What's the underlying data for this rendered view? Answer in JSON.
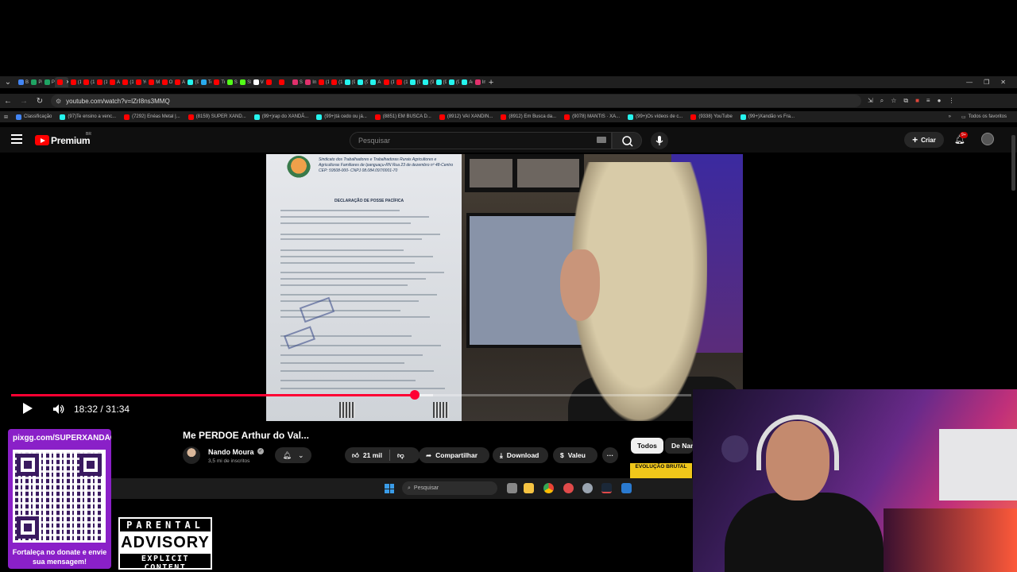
{
  "browser": {
    "tabs": [
      {
        "label": "Bi",
        "color": "#4285f4"
      },
      {
        "label": "Pi",
        "color": "#1fa463"
      },
      {
        "label": "Pi",
        "color": "#1fa463"
      },
      {
        "label": "",
        "color": "#ff0000",
        "active": true
      },
      {
        "label": "(1",
        "color": "#ff0000"
      },
      {
        "label": "(1",
        "color": "#ff0000"
      },
      {
        "label": "(1",
        "color": "#ff0000"
      },
      {
        "label": "A",
        "color": "#ff0000"
      },
      {
        "label": "(1",
        "color": "#ff0000"
      },
      {
        "label": "Yo",
        "color": "#ff0000"
      },
      {
        "label": "M",
        "color": "#ff0000"
      },
      {
        "label": "O",
        "color": "#ff0000"
      },
      {
        "label": "Al",
        "color": "#ff0000"
      },
      {
        "label": "(9",
        "color": "#25f4ee"
      },
      {
        "label": "Te",
        "color": "#2aabee"
      },
      {
        "label": "Tr",
        "color": "#ff0000"
      },
      {
        "label": "St",
        "color": "#53fc18"
      },
      {
        "label": "SI",
        "color": "#53fc18"
      },
      {
        "label": "Vi",
        "color": "#ffffff"
      },
      {
        "label": "",
        "color": "#ff0000"
      },
      {
        "label": "",
        "color": "#ff0000"
      },
      {
        "label": "St",
        "color": "#e1306c"
      },
      {
        "label": "In",
        "color": "#e1306c"
      },
      {
        "label": "(1",
        "color": "#ff0000"
      },
      {
        "label": "(1",
        "color": "#ff0000"
      },
      {
        "label": "(9",
        "color": "#25f4ee"
      },
      {
        "label": "(9",
        "color": "#25f4ee"
      },
      {
        "label": "A",
        "color": "#25f4ee"
      },
      {
        "label": "(1",
        "color": "#ff0000"
      },
      {
        "label": "(1",
        "color": "#ff0000"
      },
      {
        "label": "(9",
        "color": "#25f4ee"
      },
      {
        "label": "(9",
        "color": "#25f4ee"
      },
      {
        "label": "(9",
        "color": "#25f4ee"
      },
      {
        "label": "(9",
        "color": "#25f4ee"
      },
      {
        "label": "Ac",
        "color": "#25f4ee"
      },
      {
        "label": "In",
        "color": "#e1306c"
      }
    ],
    "url": "youtube.com/watch?v=lZrI8ns3MMQ",
    "bookmarks": [
      {
        "label": "Classificação",
        "color": "#4285f4"
      },
      {
        "label": "(97)Te ensino a venc...",
        "color": "#25f4ee"
      },
      {
        "label": "(7292) Enéas Metal |...",
        "color": "#ff0000"
      },
      {
        "label": "(8159) SUPER XAND...",
        "color": "#ff0000"
      },
      {
        "label": "(99+)rap do XANDÃ...",
        "color": "#25f4ee"
      },
      {
        "label": "(99+)tá cedo ou já...",
        "color": "#25f4ee"
      },
      {
        "label": "(8851) EM BUSCA D...",
        "color": "#ff0000"
      },
      {
        "label": "(8912) VAI XANDIN...",
        "color": "#ff0000"
      },
      {
        "label": "(8912) Em Busca da...",
        "color": "#ff0000"
      },
      {
        "label": "(9078) MANTIS · XA...",
        "color": "#ff0000"
      },
      {
        "label": "(99+)Os vídeos de c...",
        "color": "#25f4ee"
      },
      {
        "label": "(9338) YouTube",
        "color": "#ff0000"
      },
      {
        "label": "(99+)Xandão vs Fra...",
        "color": "#25f4ee"
      }
    ],
    "all_bookmarks": "Todos os favoritos"
  },
  "youtube": {
    "brand": "Premium",
    "region": "BR",
    "search_placeholder": "Pesquisar",
    "create_label": "Criar",
    "notif_count": "9+",
    "player": {
      "time": "18:32 / 31:34",
      "progress": 0.594,
      "buffered": 0.62
    },
    "video": {
      "title": "Me PERDOE Arthur do Val...",
      "channel": "Nando Moura",
      "subs": "3,5 mi de inscritos",
      "likes": "21 mil",
      "share": "Compartilhar",
      "download": "Download",
      "thanks": "Valeu",
      "more": "···"
    },
    "chips": [
      "Todos",
      "De Nan"
    ],
    "paper": {
      "header": "Sindicato dos Trabalhadores e Trabalhadoras Rurais Agricultores e Agricultoras Familiares de Ipanguaçu-RN Rua 23 de dezembro nº 48-Centro CEP: 59508-000- CNPJ 08.084.097/0001-70",
      "doc_title": "DECLARAÇÃO DE POSSE PACÍFICA"
    },
    "banner": "EVOLUÇÃO BRUTAL"
  },
  "taskbar": {
    "search": "Pesquisar"
  },
  "overlay": {
    "qr_url": "pixgg.com/SUPERXANDÃO",
    "qr_caption": "Fortaleça no donate e envie sua mensagem!",
    "advisory_top": "PARENTAL",
    "advisory_mid": "ADVISORY",
    "advisory_bot": "EXPLICIT CONTENT"
  },
  "colors": {
    "accent": "#ff0033",
    "qr_panel": "#8a20c8"
  }
}
